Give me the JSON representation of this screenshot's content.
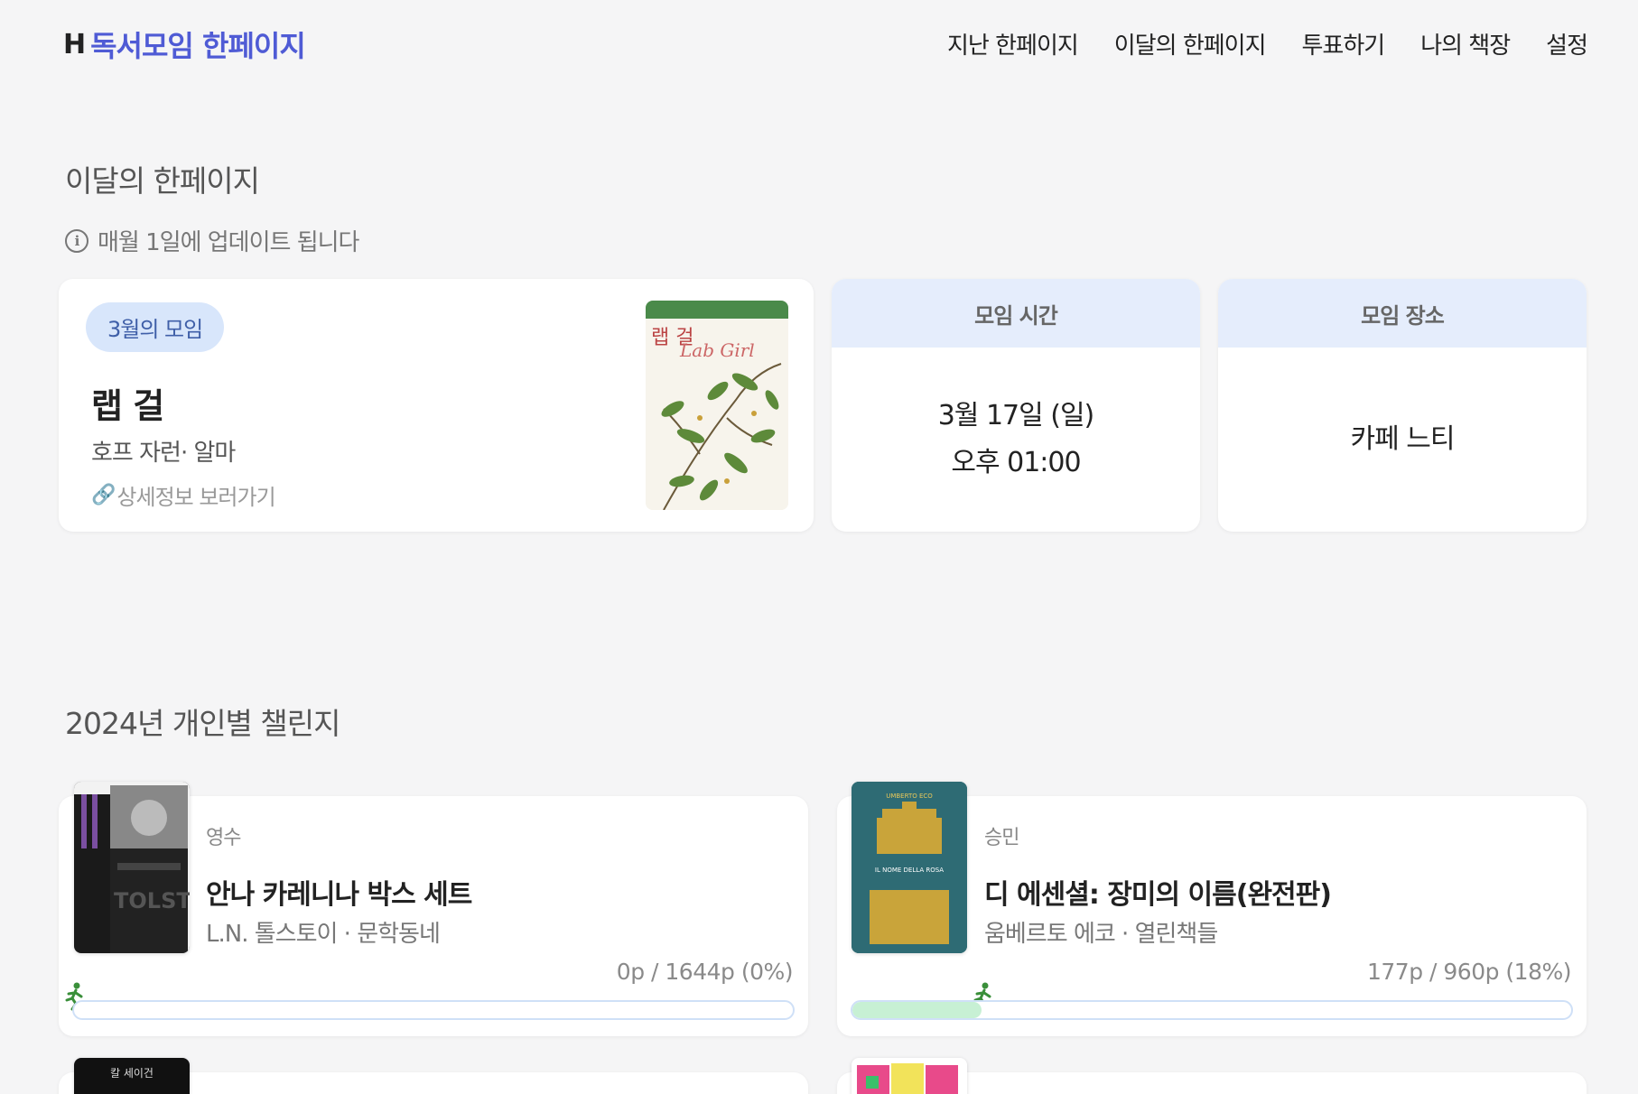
{
  "header": {
    "logo_mark": "H",
    "logo_text": "독서모임 한페이지",
    "nav": [
      "지난 한페이지",
      "이달의 한페이지",
      "투표하기",
      "나의 책장",
      "설정"
    ]
  },
  "monthly": {
    "section_title": "이달의 한페이지",
    "notice": "매월 1일에 업데이트 됩니다",
    "badge": "3월의 모임",
    "book_title": "랩 걸",
    "book_meta": "호프 자런· 알마",
    "detail_link": "상세정보 보러가기",
    "cover_title": "랩 걸",
    "cover_title_en": "Lab Girl",
    "time_label": "모임 시간",
    "time_date": "3월 17일 (일)",
    "time_hour": "오후 01:00",
    "place_label": "모임 장소",
    "place_value": "카페 느티"
  },
  "challenge": {
    "section_title": "2024년 개인별 챌린지",
    "items": [
      {
        "user": "영수",
        "title": "안나 카레니나 박스 세트",
        "meta": "L.N. 톨스토이 · 문학동네",
        "progress_text": "0p / 1644p (0%)",
        "progress": 0,
        "cover_color": "#1c1c1c"
      },
      {
        "user": "승민",
        "title": "디 에센셜: 장미의 이름(완전판)",
        "meta": "움베르토 에코 · 열린책들",
        "progress_text": "177p / 960p (18%)",
        "progress": 0.18,
        "cover_color": "#2e6b74",
        "cover_text_top": "UMBERTO ECO",
        "cover_text_mid": "IL NOME DELLA ROSA"
      },
      {
        "cover_label": "칼 세이건",
        "cover_color": "#111111"
      },
      {
        "cover_color": "#f2e35a"
      }
    ]
  },
  "colors": {
    "accent": "#4f5bd5",
    "badge_bg": "#d8e6fb",
    "card_head_bg": "#e5edfc",
    "progress_fill": "#c7f0d4",
    "runner": "#3a8f3a"
  }
}
